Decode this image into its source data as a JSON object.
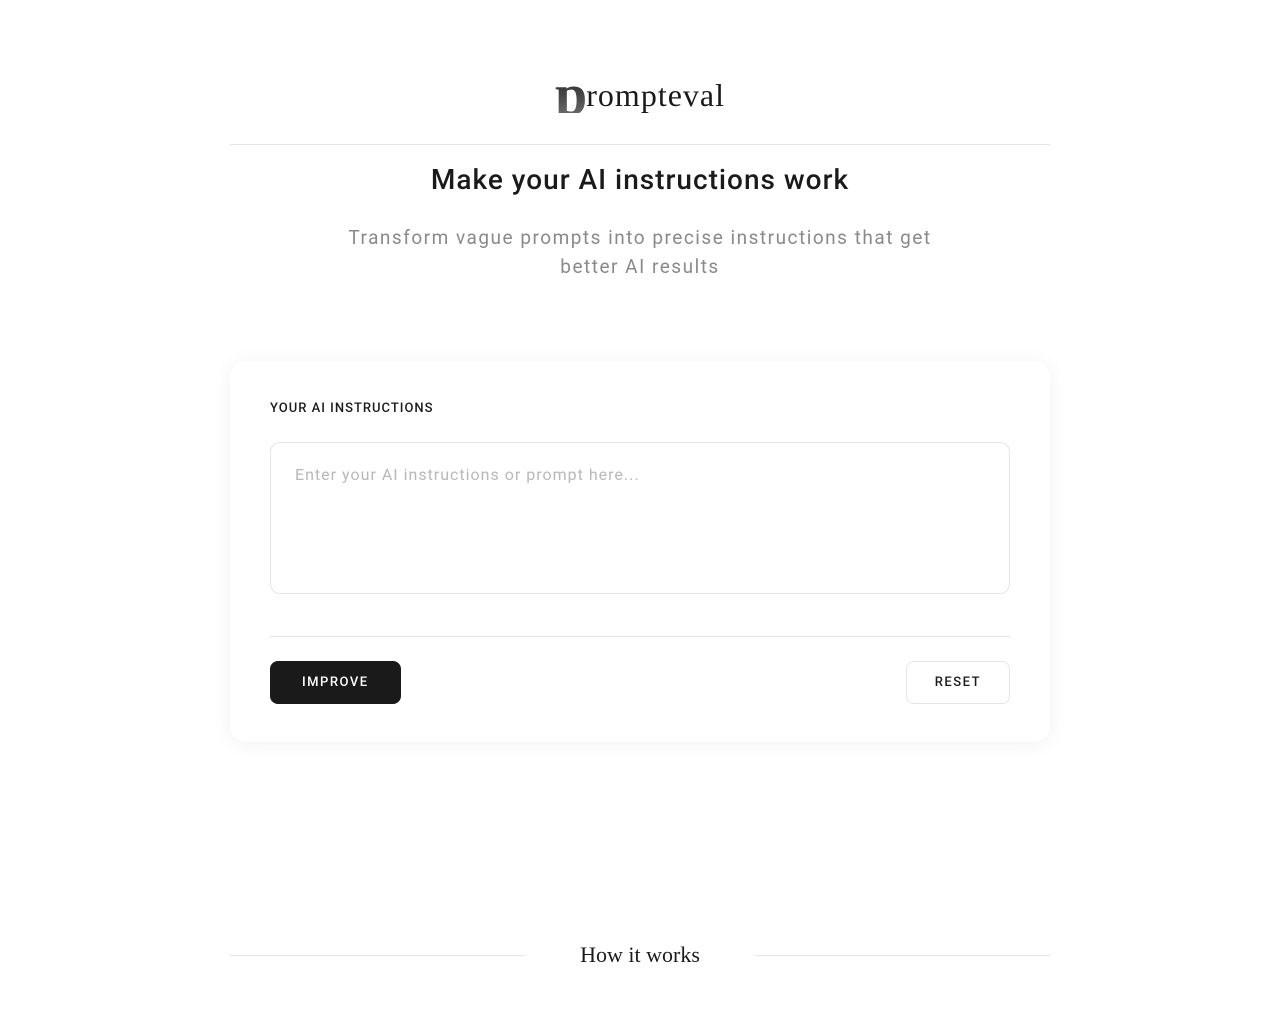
{
  "header": {
    "logo_first_letter": "p",
    "logo_rest": "rompteval"
  },
  "hero": {
    "title": "Make your AI instructions work",
    "subtitle": "Transform vague prompts into precise instructions that get better AI results"
  },
  "form": {
    "label": "YOUR AI INSTRUCTIONS",
    "placeholder": "Enter your AI instructions or prompt here...",
    "improve_label": "IMPROVE",
    "reset_label": "RESET"
  },
  "how_it_works": {
    "title": "How it works"
  }
}
